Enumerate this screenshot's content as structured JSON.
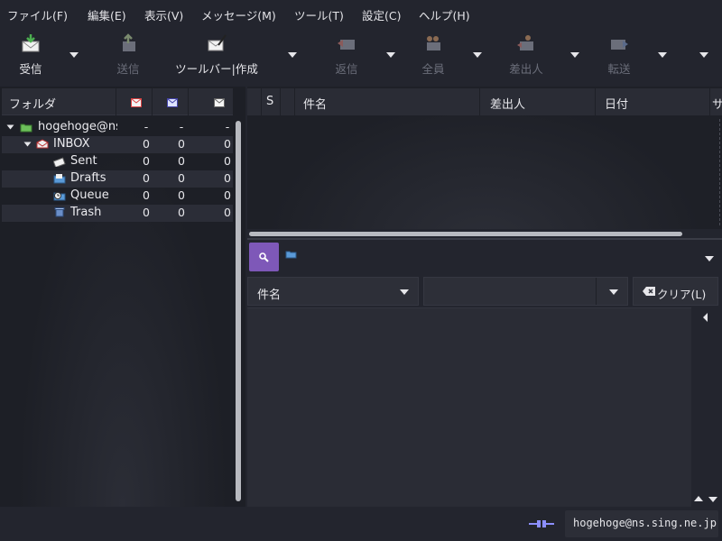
{
  "menubar": {
    "items": [
      "ファイル(F)",
      "編集(E)",
      "表示(V)",
      "メッセージ(M)",
      "ツール(T)",
      "設定(C)",
      "ヘルプ(H)"
    ]
  },
  "toolbar": {
    "receive": "受信",
    "send": "送信",
    "compose": "ツールバー|作成",
    "reply": "返信",
    "reply_all": "全員",
    "reply_sender": "差出人",
    "forward": "転送"
  },
  "folder_panel": {
    "header": "フォルダ",
    "account": {
      "name": "hogehoge@ns",
      "unread": "-",
      "new": "-",
      "total": "-"
    },
    "folders": [
      {
        "name": "INBOX",
        "unread": "0",
        "new": "0",
        "total": "0",
        "icon": "inbox-icon"
      },
      {
        "name": "Sent",
        "unread": "0",
        "new": "0",
        "total": "0",
        "icon": "sent-icon"
      },
      {
        "name": "Drafts",
        "unread": "0",
        "new": "0",
        "total": "0",
        "icon": "drafts-icon"
      },
      {
        "name": "Queue",
        "unread": "0",
        "new": "0",
        "total": "0",
        "icon": "queue-icon"
      },
      {
        "name": "Trash",
        "unread": "0",
        "new": "0",
        "total": "0",
        "icon": "trash-icon"
      }
    ]
  },
  "message_list": {
    "columns": {
      "status": "S",
      "subject": "件名",
      "from": "差出人",
      "date": "日付",
      "size": "サ"
    }
  },
  "search": {
    "field": "件名",
    "value": "",
    "clear_label": "クリア(L)"
  },
  "statusbar": {
    "account": "hogehoge@ns.sing.ne.jp"
  },
  "colors": {
    "background": "#23252e",
    "accent": "#7e58b8"
  }
}
